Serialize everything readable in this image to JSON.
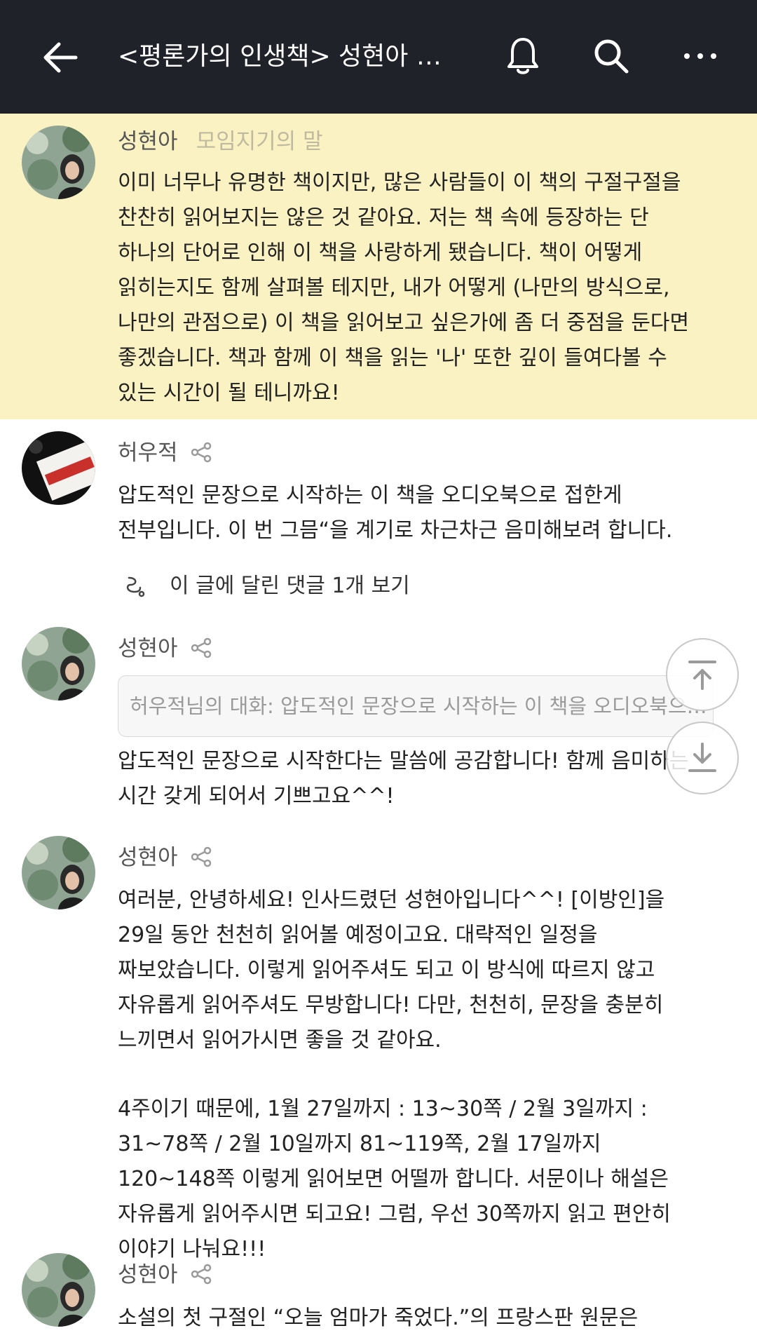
{
  "header": {
    "title": "<평론가의 인생책> 성현아 평…",
    "back_icon": "arrow-left-icon",
    "bell_icon": "bell-icon",
    "search_icon": "search-icon",
    "more_icon": "more-horizontal-icon",
    "bg_color": "#1f2229"
  },
  "posts": [
    {
      "author": "성현아",
      "role": "모임지기의 말",
      "text": "이미 너무나 유명한 책이지만, 많은 사람들이 이 책의 구절구절을 찬찬히 읽어보지는 않은 것 같아요. 저는 책 속에 등장하는 단 하나의 단어로 인해 이 책을 사랑하게 됐습니다. 책이 어떻게 읽히는지도 함께 살펴볼 테지만, 내가 어떻게 (나만의 방식으로, 나만의 관점으로) 이 책을 읽어보고 싶은가에 좀 더 중점을 둔다면 좋겠습니다. 책과 함께 이 책을 읽는 '나' 또한 깊이 들여다볼 수 있는 시간이 될 테니까요!",
      "highlight_color": "#fbf2c4"
    },
    {
      "author": "허우적",
      "text": "압도적인 문장으로 시작하는 이 책을 오디오북으로 접한게 전부입니다. 이 번 그믐“을 계기로 차근차근 음미해보려 합니다.",
      "replies": "이 글에 달린 댓글 1개 보기"
    },
    {
      "author": "성현아",
      "quote": "허우적님의 대화: 압도적인 문장으로 시작하는 이 책을 오디오북으로 접한게 전부입니다.",
      "text": "압도적인 문장으로 시작한다는 말씀에 공감합니다! 함께 음미하는 시간 갖게 되어서 기쁘고요^^!"
    },
    {
      "author": "성현아",
      "text": "여러분, 안녕하세요! 인사드렸던 성현아입니다^^! [이방인]을 29일 동안 천천히 읽어볼 예정이고요. 대략적인 일정을 짜보았습니다. 이렇게 읽어주셔도 되고 이 방식에 따르지 않고 자유롭게 읽어주셔도 무방합니다! 다만, 천천히, 문장을 충분히 느끼면서 읽어가시면 좋을 것 같아요.",
      "text2": "4주이기 때문에, 1월 27일까지 : 13~30쪽 / 2월 3일까지 : 31~78쪽 / 2월 10일까지 81~119쪽, 2월 17일까지 120~148쪽 이렇게 읽어보면 어떨까 합니다. 서문이나 해설은 자유롭게 읽어주시면 되고요! 그럼, 우선 30쪽까지 읽고 편안히 이야기 나눠요!!!"
    },
    {
      "author": "성현아",
      "text": "소설의 첫 구절인 “오늘 엄마가 죽었다.”의 프랑스판 원문은"
    }
  ],
  "icons": {
    "share": "share-icon",
    "reply": "reply-thread-icon",
    "scroll_top": "scroll-to-top-icon",
    "scroll_bottom": "scroll-to-bottom-icon"
  }
}
